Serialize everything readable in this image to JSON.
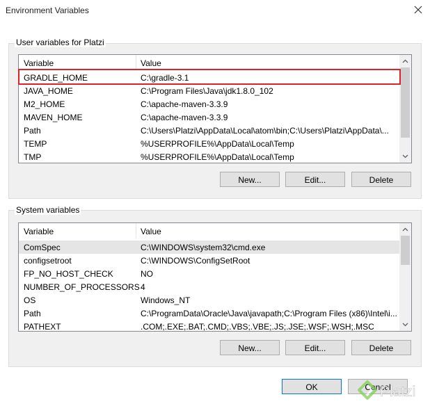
{
  "window": {
    "title": "Environment Variables"
  },
  "user_group": {
    "label": "User variables for Platzi",
    "columns": [
      "Variable",
      "Value"
    ],
    "rows": [
      [
        "GRADLE_HOME",
        "C:\\gradle-3.1"
      ],
      [
        "JAVA_HOME",
        "C:\\Program Files\\Java\\jdk1.8.0_102"
      ],
      [
        "M2_HOME",
        "C:\\apache-maven-3.3.9"
      ],
      [
        "MAVEN_HOME",
        "C:\\apache-maven-3.3.9"
      ],
      [
        "Path",
        "C:\\Users\\Platzi\\AppData\\Local\\atom\\bin;C:\\Users\\Platzi\\AppData\\..."
      ],
      [
        "TEMP",
        "%USERPROFILE%\\AppData\\Local\\Temp"
      ],
      [
        "TMP",
        "%USERPROFILE%\\AppData\\Local\\Temp"
      ]
    ],
    "buttons": {
      "new": "New...",
      "edit": "Edit...",
      "delete": "Delete"
    }
  },
  "system_group": {
    "label": "System variables",
    "columns": [
      "Variable",
      "Value"
    ],
    "rows": [
      [
        "ComSpec",
        "C:\\WINDOWS\\system32\\cmd.exe"
      ],
      [
        "configsetroot",
        "C:\\WINDOWS\\ConfigSetRoot"
      ],
      [
        "FP_NO_HOST_CHECK",
        "NO"
      ],
      [
        "NUMBER_OF_PROCESSORS",
        "4"
      ],
      [
        "OS",
        "Windows_NT"
      ],
      [
        "Path",
        "C:\\ProgramData\\Oracle\\Java\\javapath;C:\\Program Files (x86)\\Intel\\i..."
      ],
      [
        "PATHEXT",
        ".COM;.EXE;.BAT;.CMD;.VBS;.VBE;.JS;.JSE;.WSF;.WSH;.MSC"
      ]
    ],
    "buttons": {
      "new": "New...",
      "edit": "Edit...",
      "delete": "Delete"
    }
  },
  "footer": {
    "ok": "OK",
    "cancel": "Cancel"
  },
  "watermark": {
    "text": "Platzi"
  },
  "colors": {
    "highlight": "#e0202a",
    "accent": "#0078d7",
    "watermark": "#7fcf54"
  }
}
